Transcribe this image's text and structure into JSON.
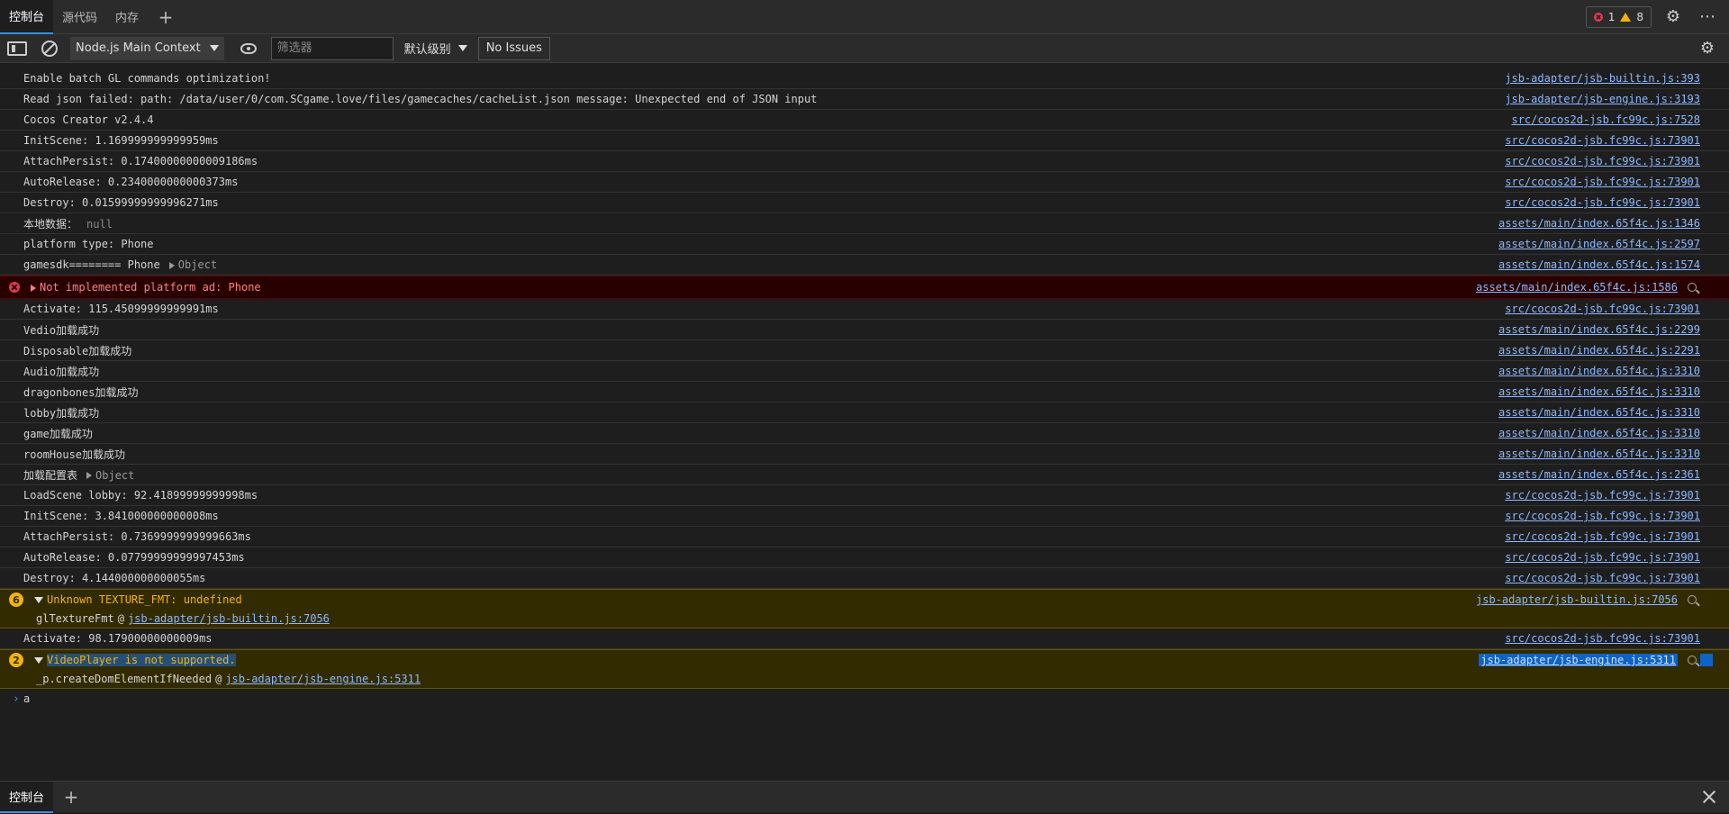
{
  "tabs": [
    "控制台",
    "源代码",
    "内存"
  ],
  "issues": {
    "errors": "1",
    "warnings": "8"
  },
  "toolbar": {
    "context": "Node.js Main Context",
    "filter_placeholder": "筛选器",
    "level": "默认级别",
    "no_issues": "No Issues"
  },
  "logs": [
    {
      "msg": "Enable batch GL commands optimization!",
      "src": "jsb-adapter/jsb-builtin.js:393"
    },
    {
      "msg": "Read json failed: path: /data/user/0/com.SCgame.love/files/gamecaches/cacheList.json message: Unexpected end of JSON input",
      "src": "jsb-adapter/jsb-engine.js:3193"
    },
    {
      "msg": "Cocos Creator v2.4.4",
      "src": "src/cocos2d-jsb.fc99c.js:7528"
    },
    {
      "msg": "InitScene: 1.169999999999959ms",
      "src": "src/cocos2d-jsb.fc99c.js:73901"
    },
    {
      "msg": "AttachPersist: 0.17400000000009186ms",
      "src": "src/cocos2d-jsb.fc99c.js:73901"
    },
    {
      "msg": "AutoRelease: 0.2340000000000373ms",
      "src": "src/cocos2d-jsb.fc99c.js:73901"
    },
    {
      "msg": "Destroy: 0.01599999999996271ms",
      "src": "src/cocos2d-jsb.fc99c.js:73901"
    },
    {
      "msg": "本地数据：",
      "extra": "null",
      "src": "assets/main/index.65f4c.js:1346"
    },
    {
      "msg": "platform type: Phone",
      "src": "assets/main/index.65f4c.js:2597"
    },
    {
      "msg": "gamesdk======== Phone",
      "extra": "Object",
      "src": "assets/main/index.65f4c.js:1574"
    }
  ],
  "error": {
    "msg": "Not implemented platform ad: Phone",
    "src": "assets/main/index.65f4c.js:1586"
  },
  "logs2": [
    {
      "msg": "Activate: 115.45099999999991ms",
      "src": "src/cocos2d-jsb.fc99c.js:73901"
    },
    {
      "msg": "Vedio加载成功",
      "src": "assets/main/index.65f4c.js:2299"
    },
    {
      "msg": "Disposable加载成功",
      "src": "assets/main/index.65f4c.js:2291"
    },
    {
      "msg": "Audio加载成功",
      "src": "assets/main/index.65f4c.js:3310"
    },
    {
      "msg": "dragonbones加载成功",
      "src": "assets/main/index.65f4c.js:3310"
    },
    {
      "msg": "lobby加载成功",
      "src": "assets/main/index.65f4c.js:3310"
    },
    {
      "msg": "game加载成功",
      "src": "assets/main/index.65f4c.js:3310"
    },
    {
      "msg": "roomHouse加载成功",
      "src": "assets/main/index.65f4c.js:3310"
    },
    {
      "msg": "加载配置表",
      "extra": "Object",
      "src": "assets/main/index.65f4c.js:2361"
    },
    {
      "msg": "LoadScene lobby: 92.41899999999998ms",
      "src": "src/cocos2d-jsb.fc99c.js:73901"
    },
    {
      "msg": "InitScene: 3.841000000000008ms",
      "src": "src/cocos2d-jsb.fc99c.js:73901"
    },
    {
      "msg": "AttachPersist: 0.7369999999999663ms",
      "src": "src/cocos2d-jsb.fc99c.js:73901"
    },
    {
      "msg": "AutoRelease: 0.07799999999997453ms",
      "src": "src/cocos2d-jsb.fc99c.js:73901"
    },
    {
      "msg": "Destroy: 4.144000000000055ms",
      "src": "src/cocos2d-jsb.fc99c.js:73901"
    }
  ],
  "warn1": {
    "count": "6",
    "msg": "Unknown TEXTURE_FMT: undefined",
    "src": "jsb-adapter/jsb-builtin.js:7056",
    "stack_fn": "glTextureFmt",
    "stack_at": "@",
    "stack_link": "jsb-adapter/jsb-builtin.js:7056"
  },
  "log_after_warn": {
    "msg": "Activate: 98.17900000000009ms",
    "src": "src/cocos2d-jsb.fc99c.js:73901"
  },
  "warn2": {
    "count": "2",
    "msg": "VideoPlayer is not supported.",
    "src": "jsb-adapter/jsb-engine.js:5311",
    "stack_fn": "_p.createDomElementIfNeeded",
    "stack_at": "@",
    "stack_link": "jsb-adapter/jsb-engine.js:5311"
  },
  "prompt": {
    "caret": "›",
    "text": "a"
  },
  "drawer": {
    "tab": "控制台"
  }
}
